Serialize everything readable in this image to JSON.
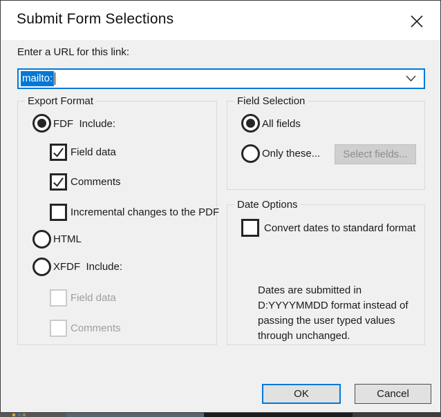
{
  "dialog": {
    "title": "Submit Form Selections",
    "close_icon": "close"
  },
  "url_section": {
    "label": "Enter a URL for this link:",
    "value": "mailto:"
  },
  "export_format": {
    "legend": "Export Format",
    "fdf_label": "FDF  Include:",
    "fdf_field_data_label": "Field data",
    "fdf_comments_label": "Comments",
    "incremental_label": "Incremental changes to the PDF",
    "html_label": "HTML",
    "xfdf_label": "XFDF  Include:",
    "xfdf_field_data_label": "Field data",
    "xfdf_comments_label": "Comments"
  },
  "field_selection": {
    "legend": "Field Selection",
    "all_fields_label": "All fields",
    "only_these_label": "Only these...",
    "select_fields_button": "Select fields..."
  },
  "date_options": {
    "legend": "Date Options",
    "convert_label": "Convert dates to standard format",
    "note": "Dates are submitted in\nD:YYYYMMDD format instead of\npassing the user typed values\nthrough unchanged."
  },
  "actions": {
    "ok": "OK",
    "cancel": "Cancel"
  },
  "colors": {
    "accent": "#0078d7",
    "dialog_bg": "#f0f0f0",
    "titlebar_bg": "#ffffff",
    "control_border": "#262626",
    "disabled_text": "#9e9e9e"
  }
}
